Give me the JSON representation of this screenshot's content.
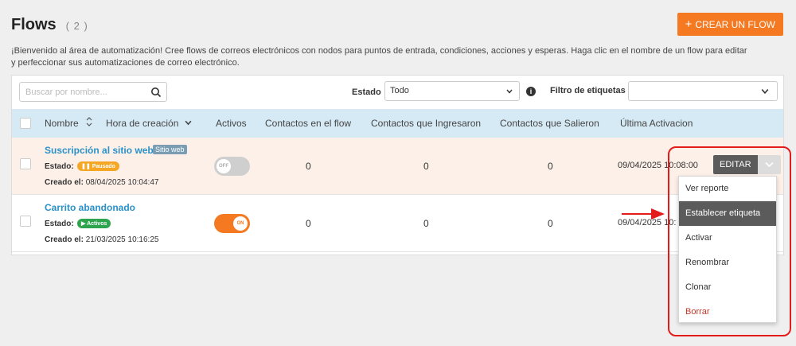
{
  "header": {
    "title": "Flows",
    "count": "( 2 )",
    "create_button": "CREAR UN FLOW"
  },
  "intro": "¡Bienvenido al área de automatización! Cree flows de correos electrónicos con nodos para puntos de entrada, condiciones, acciones y esperas. Haga clic en el nombre de un flow para editar y perfeccionar sus automatizaciones de correo electrónico.",
  "filters": {
    "search_placeholder": "Buscar por nombre...",
    "estado_label": "Estado",
    "estado_value": "Todo",
    "tag_filter_label": "Filtro de etiquetas",
    "tag_filter_value": ""
  },
  "table": {
    "columns": [
      "Nombre",
      "Hora de creación",
      "Activos",
      "Contactos en el flow",
      "Contactos que Ingresaron",
      "Contactos que Salieron",
      "Última Activacion"
    ],
    "rows": [
      {
        "name": "Suscripción al sitio web",
        "tag": "Sitio web",
        "estado_label": "Estado:",
        "status": "Pausado",
        "created_label": "Creado el:",
        "created": "08/04/2025 10:04:47",
        "active_toggle": "OFF",
        "in_flow": "0",
        "entered": "0",
        "exited": "0",
        "last_activation": "09/04/2025 10:08:00"
      },
      {
        "name": "Carrito abandonado",
        "tag": "",
        "estado_label": "Estado:",
        "status": "Activos",
        "created_label": "Creado el:",
        "created": "21/03/2025 10:16:25",
        "active_toggle": "ON",
        "in_flow": "0",
        "entered": "0",
        "exited": "0",
        "last_activation": "09/04/2025 10:"
      }
    ]
  },
  "row_actions": {
    "edit_label": "EDITAR",
    "menu": [
      "Ver reporte",
      "Establecer etiqueta",
      "Activar",
      "Renombrar",
      "Clonar",
      "Borrar"
    ],
    "highlighted_item": "Establecer etiqueta"
  },
  "colors": {
    "accent": "#f47920",
    "link": "#2a91c9",
    "annotation": "#e41b1b"
  }
}
